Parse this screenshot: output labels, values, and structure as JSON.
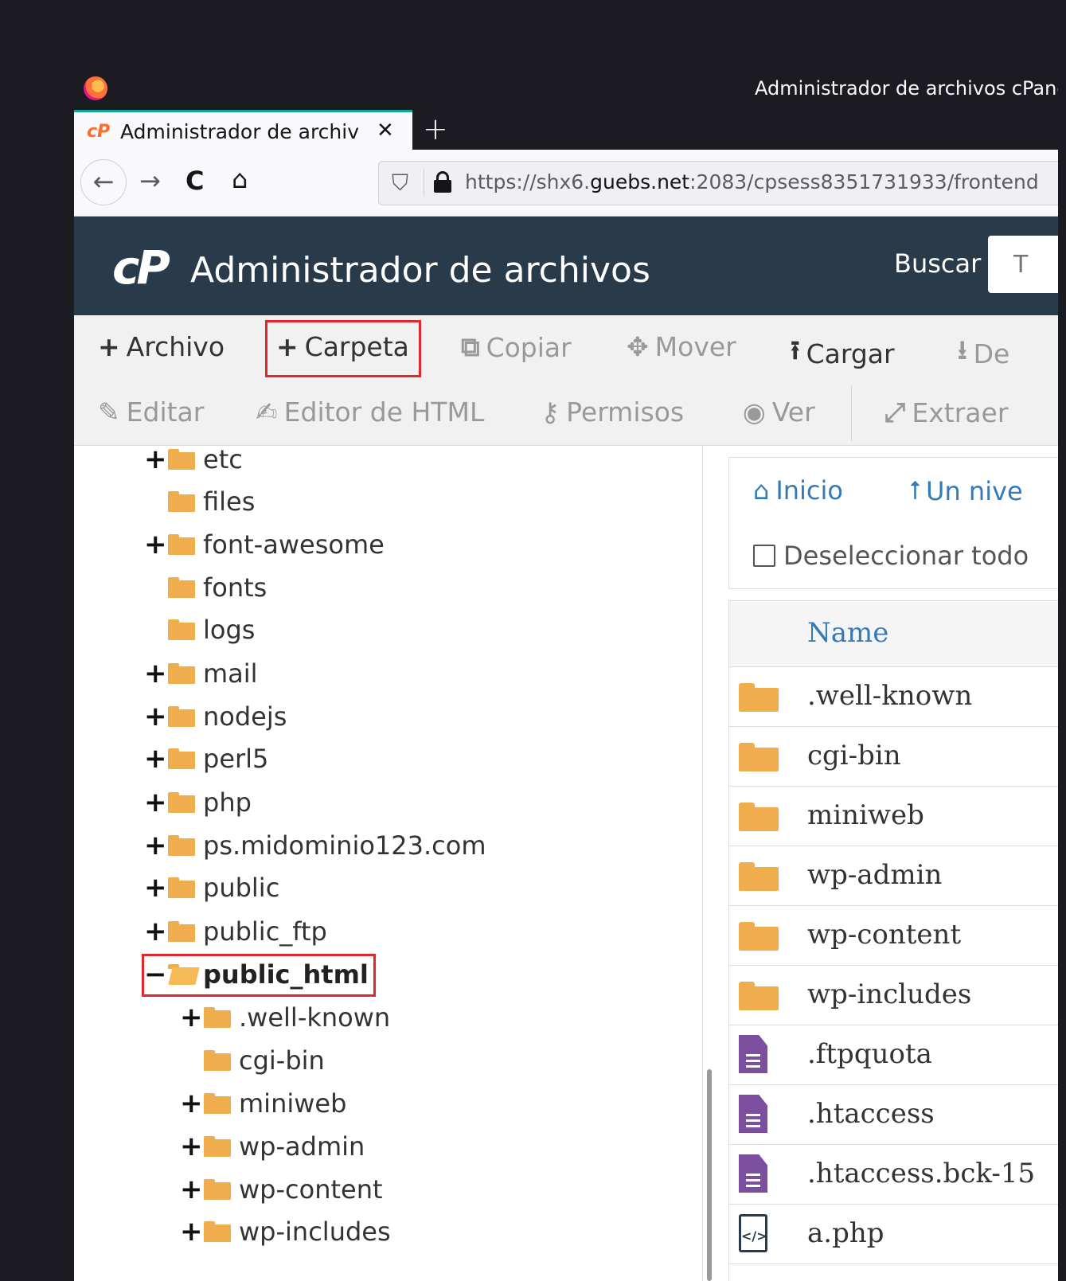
{
  "browser": {
    "window_title": "Administrador de archivos cPanel",
    "tab_title": "Administrador de archivos",
    "tab_favicon": "cP",
    "url_prefix": "https://shx6.",
    "url_domain": "guebs.net",
    "url_suffix": ":2083/cpsess8351731933/frontend"
  },
  "icons": {
    "back": "←",
    "forward": "→",
    "reload": "C",
    "home": "⌂",
    "close": "✕",
    "new_tab": "+",
    "shield": "⛉"
  },
  "header": {
    "logo": "cP",
    "title": "Administrador de archivos",
    "search_label": "Buscar",
    "search_placeholder": "T"
  },
  "toolbar": {
    "row1": [
      {
        "label": "Archivo",
        "icon": "+",
        "enabled": true
      },
      {
        "label": "Carpeta",
        "icon": "+",
        "enabled": true,
        "highlighted": true
      },
      {
        "label": "Copiar",
        "icon": "⧉",
        "enabled": false
      },
      {
        "label": "Mover",
        "icon": "✥",
        "enabled": false
      },
      {
        "label": "Cargar",
        "icon": "⭱",
        "enabled": true
      },
      {
        "label": "De",
        "icon": "⭳",
        "enabled": false
      }
    ],
    "row2": [
      {
        "label": "Editar",
        "icon": "✎",
        "enabled": false
      },
      {
        "label": "Editor de HTML",
        "icon": "✍",
        "enabled": false
      },
      {
        "label": "Permisos",
        "icon": "⚷",
        "enabled": false
      },
      {
        "label": "Ver",
        "icon": "◉",
        "enabled": false
      },
      {
        "label": "Extraer",
        "icon": "⤢",
        "enabled": false
      }
    ]
  },
  "tree": {
    "items": [
      {
        "label": "etc",
        "toggle": "+",
        "level": 0
      },
      {
        "label": "files",
        "toggle": "",
        "level": 0
      },
      {
        "label": "font-awesome",
        "toggle": "+",
        "level": 0
      },
      {
        "label": "fonts",
        "toggle": "",
        "level": 0
      },
      {
        "label": "logs",
        "toggle": "",
        "level": 0
      },
      {
        "label": "mail",
        "toggle": "+",
        "level": 0
      },
      {
        "label": "nodejs",
        "toggle": "+",
        "level": 0
      },
      {
        "label": "perl5",
        "toggle": "+",
        "level": 0
      },
      {
        "label": "php",
        "toggle": "+",
        "level": 0
      },
      {
        "label": "ps.midominio123.com",
        "toggle": "+",
        "level": 0
      },
      {
        "label": "public",
        "toggle": "+",
        "level": 0
      },
      {
        "label": "public_ftp",
        "toggle": "+",
        "level": 0
      },
      {
        "label": "public_html",
        "toggle": "−",
        "level": 0,
        "open": true,
        "highlighted": true
      },
      {
        "label": ".well-known",
        "toggle": "+",
        "level": 1
      },
      {
        "label": "cgi-bin",
        "toggle": "",
        "level": 1
      },
      {
        "label": "miniweb",
        "toggle": "+",
        "level": 1
      },
      {
        "label": "wp-admin",
        "toggle": "+",
        "level": 1
      },
      {
        "label": "wp-content",
        "toggle": "+",
        "level": 1
      },
      {
        "label": "wp-includes",
        "toggle": "+",
        "level": 1
      }
    ]
  },
  "filelist": {
    "home_label": "Inicio",
    "up_label": "Un nive",
    "deselect_label": "Deseleccionar todo",
    "name_header": "Name",
    "files": [
      {
        "name": ".well-known",
        "type": "folder"
      },
      {
        "name": "cgi-bin",
        "type": "folder"
      },
      {
        "name": "miniweb",
        "type": "folder"
      },
      {
        "name": "wp-admin",
        "type": "folder"
      },
      {
        "name": "wp-content",
        "type": "folder"
      },
      {
        "name": "wp-includes",
        "type": "folder"
      },
      {
        "name": ".ftpquota",
        "type": "text"
      },
      {
        "name": ".htaccess",
        "type": "text"
      },
      {
        "name": ".htaccess.bck-15",
        "type": "text"
      },
      {
        "name": "a.php",
        "type": "code"
      }
    ]
  },
  "colors": {
    "header_bg": "#293a4a",
    "folder": "#f0ad4e",
    "link": "#337ab7",
    "highlight": "#e3262e",
    "doc": "#7b4e9e"
  }
}
